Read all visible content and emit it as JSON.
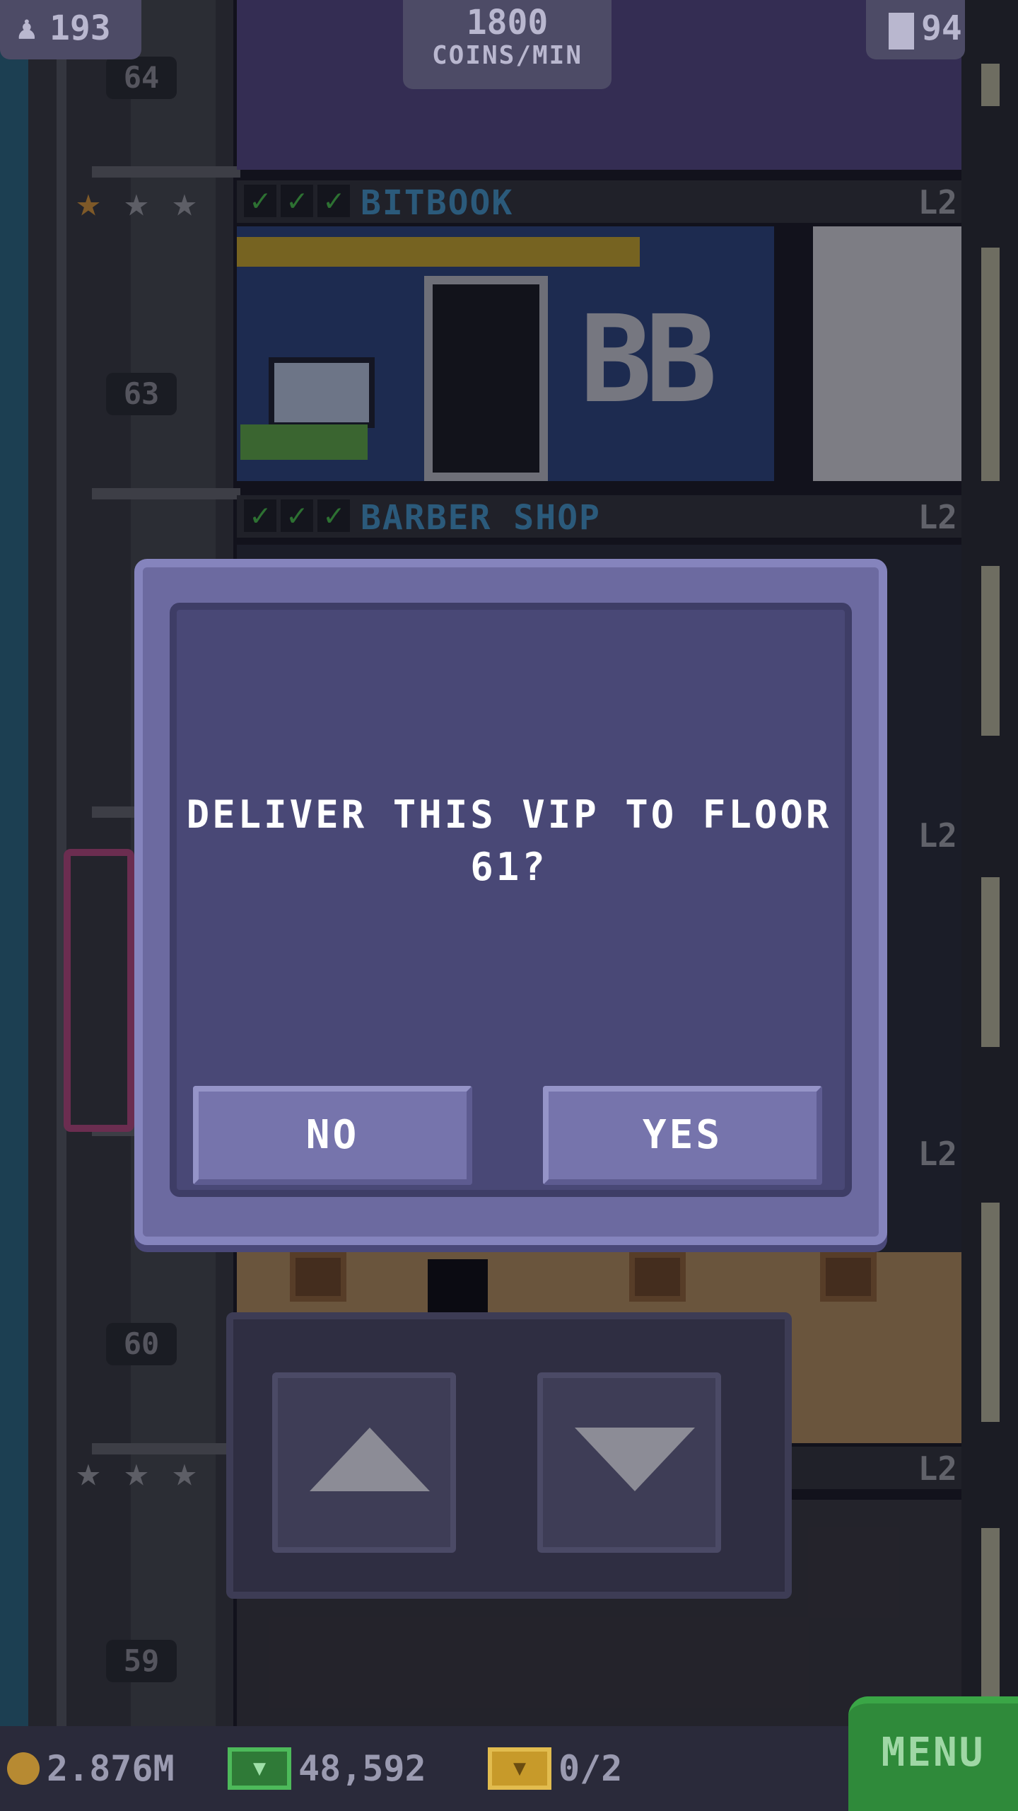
{
  "hud": {
    "population": "193",
    "coin_rate_value": "1800",
    "coin_rate_unit": "COINS/MIN",
    "floor_count": "94"
  },
  "floors": {
    "f64": "64",
    "f63": "63",
    "f60": "60",
    "f59": "59"
  },
  "rooms": [
    {
      "name": "BITBOOK",
      "level": "L2"
    },
    {
      "name": "BARBER SHOP",
      "level": "L2"
    }
  ],
  "room_levels_hidden": [
    "L2",
    "L2",
    "L2"
  ],
  "bitbook_logo": "BB",
  "dialog": {
    "line1": "DELIVER THIS VIP TO FLOOR",
    "line2": "61?",
    "no_label": "NO",
    "yes_label": "YES"
  },
  "bottom": {
    "coins": "2.876M",
    "bux": "48,592",
    "tickets": "0/2",
    "menu_label": "MENU"
  },
  "colors": {
    "dialog_bg": "#494876",
    "dialog_frame": "#6c6aa0",
    "button_bg": "#7674ac",
    "menu_green": "#2f8a3a",
    "room_title_blue": "#4aa3d8",
    "check_green": "#4ed04e"
  }
}
